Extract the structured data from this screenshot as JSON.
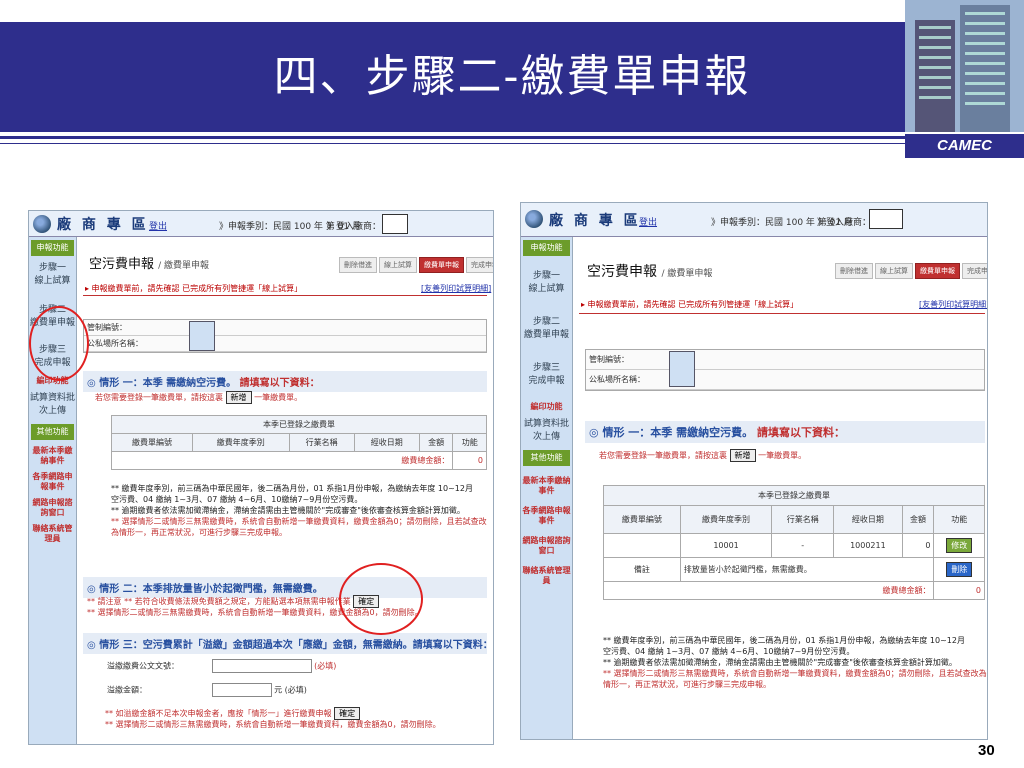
{
  "slide": {
    "title": "四、步驟二-繳費單申報",
    "brand": "CAMEC",
    "page_number": "30"
  },
  "header": {
    "logo_text": "廠 商 專 區",
    "logout": "登出",
    "period_left": "》申報季別：民國 100 年 第 01 月",
    "login_left": "》登入廠商：",
    "period_right": "》申報季別：民國 100 年 第 01 月",
    "login_right": "》登入廠商："
  },
  "sidebar": {
    "caption_function": "申報功能",
    "step1": "步驟一",
    "step1_label": "線上試算",
    "step2": "步驟二",
    "step2_label": "繳費單申報",
    "step3": "步驟三",
    "step3_label": "完成申報",
    "edit": "編印功能",
    "print": "試算資料批次上傳",
    "caption_other": "其他功能",
    "links": [
      "最新本季繳納事件",
      "各季網路申報事件",
      "網路申報諮詢窗口",
      "聯絡系統管理員"
    ]
  },
  "main": {
    "page_title": "空污費申報",
    "page_subtitle": "/ 繳費單申報",
    "steps": [
      "刪除借進",
      "線上試算",
      "繳費單申報",
      "完成申報"
    ],
    "notice": "▸ 申報繳費單前，請先確認 已完成所有列管捷運「線上試算」",
    "print_link": "[友善列印試算明細]",
    "field1": "管制編號：",
    "field2": "公私場所名稱：",
    "sec1_title": "情形 一：本季 需繳納空污費。",
    "sec1_hint": "請填寫以下資料：",
    "sec1_sub": "若您需要登錄一筆繳費單，請按這裏",
    "add_button": "新增",
    "sec1_sub_tail": "一筆繳費單。",
    "table_caption": "本季已登錄之繳費單",
    "table_headers": [
      "繳費單編號",
      "繳費年度季別",
      "行業名稱",
      "經收日期",
      "金額",
      "功能"
    ],
    "total_label": "繳費總金額：",
    "total_value": "0",
    "row1": [
      "10001",
      "-",
      "1000211",
      "0"
    ],
    "row1_edit": "修改",
    "row2_label": "備註",
    "row2_text": "排放量皆小於起徵門檻，無需繳費。",
    "row2_delete": "刪除",
    "note1": "** 繳費年度季別，前三碼為中華民國年，後二碼為月份，01 系指1月份申報，為繳納去年度 10~12月",
    "note2": "空污費、04 繳納 1~3月、07 繳納 4~6月、10繳納7~9月份空污費。",
    "note3": "** 逾期繳費者依法需加徵滯納金，滯納金請需由主管機關於\"完成審查\"後依審查核算金額計算加徵。",
    "note4": "** 選擇情形二或情形三無需繳費時，系統會自動新增一筆繳費資料，繳費金額為0；請勿刪除，且若試查改為情形一，再正常狀況，可進行步驟三完成申報。",
    "sec2_title": "情形 二：本季排放量皆小於起徵門檻，無需繳費。",
    "sec2_n1": "** 請注意 ** 若符合收費條法規免費額之規定，方能點選本項無需申報作業",
    "confirm": "確定",
    "sec2_n2": "** 選擇情形二或情形三無需繳費時，系統會自動新增一筆繳費資料，繳費金額為0，請勿刪除。",
    "sec3_title": "情形 三：空污費累計「溢繳」金額超過本次「應繳」金額，無需繳納。請填寫以下資料：",
    "sec3_f1": "溢繳繳費公文文號：",
    "sec3_f1_req": "(必填)",
    "sec3_f2": "溢繳金額：",
    "sec3_f2_req": "元 (必填)",
    "sec3_n1": "** 如溢繳金額不足本次申報金者，應按「情形一」進行繳費申報",
    "sec3_n2": "** 選擇情形二或情形三無需繳費時，系統會自動新增一筆繳費資料，繳費金額為0，請勿刪除。"
  },
  "colors": {
    "banner": "#2e2e8c",
    "accent_red": "#c03030",
    "link_blue": "#2850a0"
  }
}
